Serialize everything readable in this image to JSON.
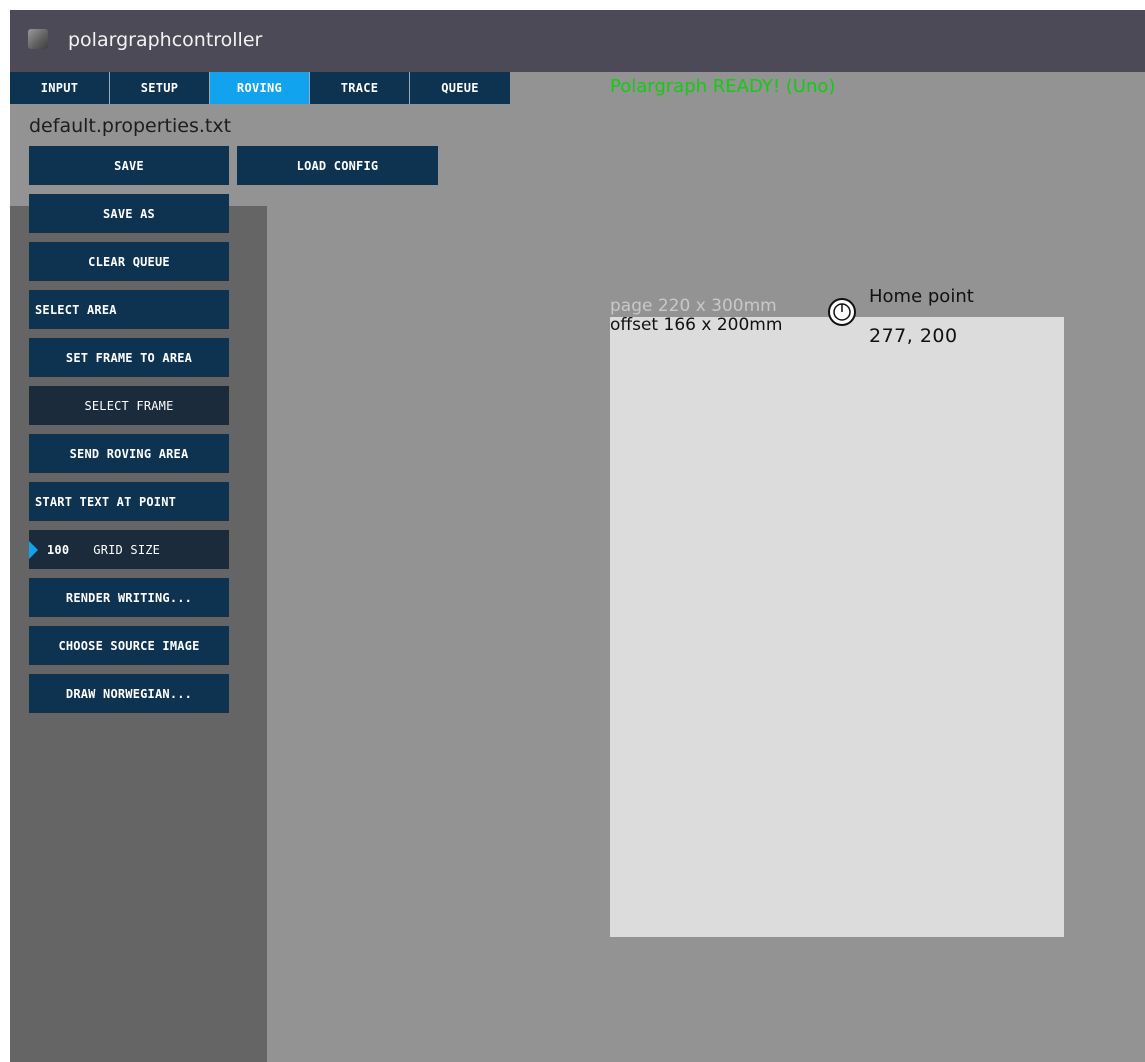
{
  "window": {
    "title": "polargraphcontroller",
    "icon": "app-icon"
  },
  "tabs": [
    {
      "label": "INPUT",
      "active": false
    },
    {
      "label": "SETUP",
      "active": false
    },
    {
      "label": "ROVING",
      "active": true
    },
    {
      "label": "TRACE",
      "active": false
    },
    {
      "label": "QUEUE",
      "active": false
    }
  ],
  "config_file": "default.properties.txt",
  "status": {
    "text": "Polargraph READY! (Uno)",
    "color": "#11cc11"
  },
  "buttons": {
    "save": "SAVE",
    "load_config": "LOAD CONFIG",
    "save_as": "SAVE AS",
    "clear_queue": "CLEAR QUEUE",
    "select_area": "SELECT AREA",
    "set_frame_to_area": "SET FRAME TO AREA",
    "select_frame": "SELECT FRAME",
    "send_roving_area": "SEND ROVING AREA",
    "start_text_at_point": "START TEXT AT POINT",
    "grid_size": {
      "value": "100",
      "label": "GRID SIZE"
    },
    "render_writing": "RENDER WRITING...",
    "choose_source_image": "CHOOSE SOURCE IMAGE",
    "draw_norwegian": "DRAW NORWEGIAN..."
  },
  "canvas": {
    "page_label": "page 220 x 300mm",
    "offset_label": "offset 166 x 200mm",
    "home_point": {
      "label": "Home point",
      "coords": "277, 200",
      "icon": "home-point-icon"
    }
  },
  "colors": {
    "button_bg": "#0d3350",
    "active_tab": "#12a3ee",
    "panel_bg": "#656565",
    "canvas_bg": "#939393",
    "page_bg": "#dcdcdc",
    "titlebar_bg": "#4b4a56"
  }
}
